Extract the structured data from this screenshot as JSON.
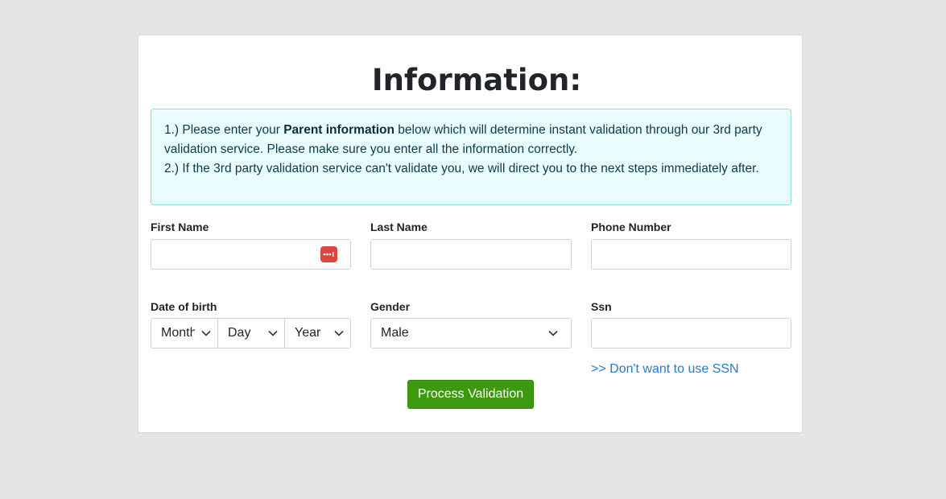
{
  "form": {
    "title": "Information:",
    "notice": {
      "line1_prefix": "1.) Please enter your ",
      "line1_bold": "Parent information",
      "line1_suffix": " below which will determine instant validation through our 3rd party validation service. Please make sure you enter all the information correctly.",
      "line2": "2.) If the 3rd party validation service can't validate you, we will direct you to the next steps immediately after."
    },
    "fields": {
      "first_name": {
        "label": "First Name",
        "value": ""
      },
      "last_name": {
        "label": "Last Name",
        "value": ""
      },
      "phone": {
        "label": "Phone Number",
        "value": ""
      },
      "dob": {
        "label": "Date of birth",
        "month": "Month",
        "day": "Day",
        "year": "Year"
      },
      "gender": {
        "label": "Gender",
        "value": "Male"
      },
      "ssn": {
        "label": "Ssn",
        "value": ""
      }
    },
    "ssn_link": ">> Don't want to use SSN",
    "submit_label": "Process Validation"
  },
  "colors": {
    "accent_button": "#3d9a0e",
    "link": "#2a7ac9",
    "notice_bg": "#e9fdfe",
    "password_manager_icon": "#d9473f"
  },
  "icons": [
    "password-manager-icon",
    "chevron-down-icon"
  ]
}
